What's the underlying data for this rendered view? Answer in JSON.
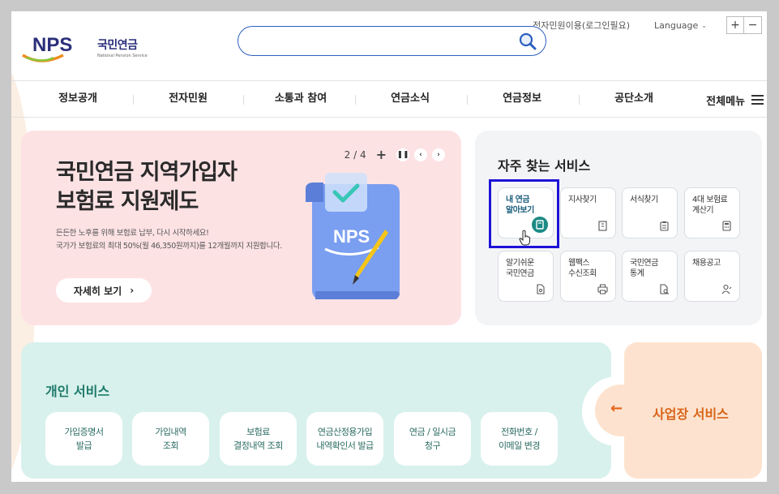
{
  "header": {
    "civil_login": "전자민원이용(로그인필요)",
    "language": "Language",
    "zoom_in": "+",
    "zoom_out": "−",
    "logo_ko": "국민연금",
    "logo_en": "National Pension Service",
    "logo_mark": "NPS",
    "search_value": ""
  },
  "nav": {
    "items": [
      "정보공개",
      "전자민원",
      "소통과 참여",
      "연금소식",
      "연금정보",
      "공단소개"
    ],
    "all_menu": "전체메뉴"
  },
  "banner": {
    "page": "2 / 4",
    "title_line1": "국민연금 지역가입자",
    "title_line2": "보험료 지원제도",
    "desc_line1": "든든한 노후를 위해 보험료 납부, 다시 시작하세요!",
    "desc_line2": "국가가 보험료의 최대 50%(월 46,350원까지)를 12개월까지 지원합니다.",
    "more_label": "자세히 보기",
    "illustration_text": "NPS"
  },
  "frequent": {
    "title": "자주 찾는 서비스",
    "items": [
      {
        "label": "내 연금\n알아보기",
        "icon": "pension-doc-icon"
      },
      {
        "label": "지사찾기",
        "icon": "building-icon"
      },
      {
        "label": "서식찾기",
        "icon": "clipboard-icon"
      },
      {
        "label": "4대 보험료\n계산기",
        "icon": "calculator-icon"
      },
      {
        "label": "알기쉬운\n국민연금",
        "icon": "document-icon"
      },
      {
        "label": "웹팩스\n수신조회",
        "icon": "printer-icon"
      },
      {
        "label": "국민연금\n통계",
        "icon": "search-doc-icon"
      },
      {
        "label": "채용공고",
        "icon": "person-icon"
      }
    ]
  },
  "personal": {
    "title": "개인 서비스",
    "items": [
      "가입증명서\n발급",
      "가입내역\n조회",
      "보험료\n결정내역 조회",
      "연금산정용가입\n내역확인서 발급",
      "연금 / 일시금\n청구",
      "전화번호 /\n이메일 변경"
    ]
  },
  "business": {
    "label": "사업장 서비스",
    "arrow": "←"
  },
  "colors": {
    "brand_blue": "#2a2f7a",
    "search_border": "#2d5fbf",
    "banner_bg": "#fde2e4",
    "personal_bg": "#d8f1ec",
    "business_bg": "#fde3cf",
    "highlight": "#1d12d6"
  }
}
